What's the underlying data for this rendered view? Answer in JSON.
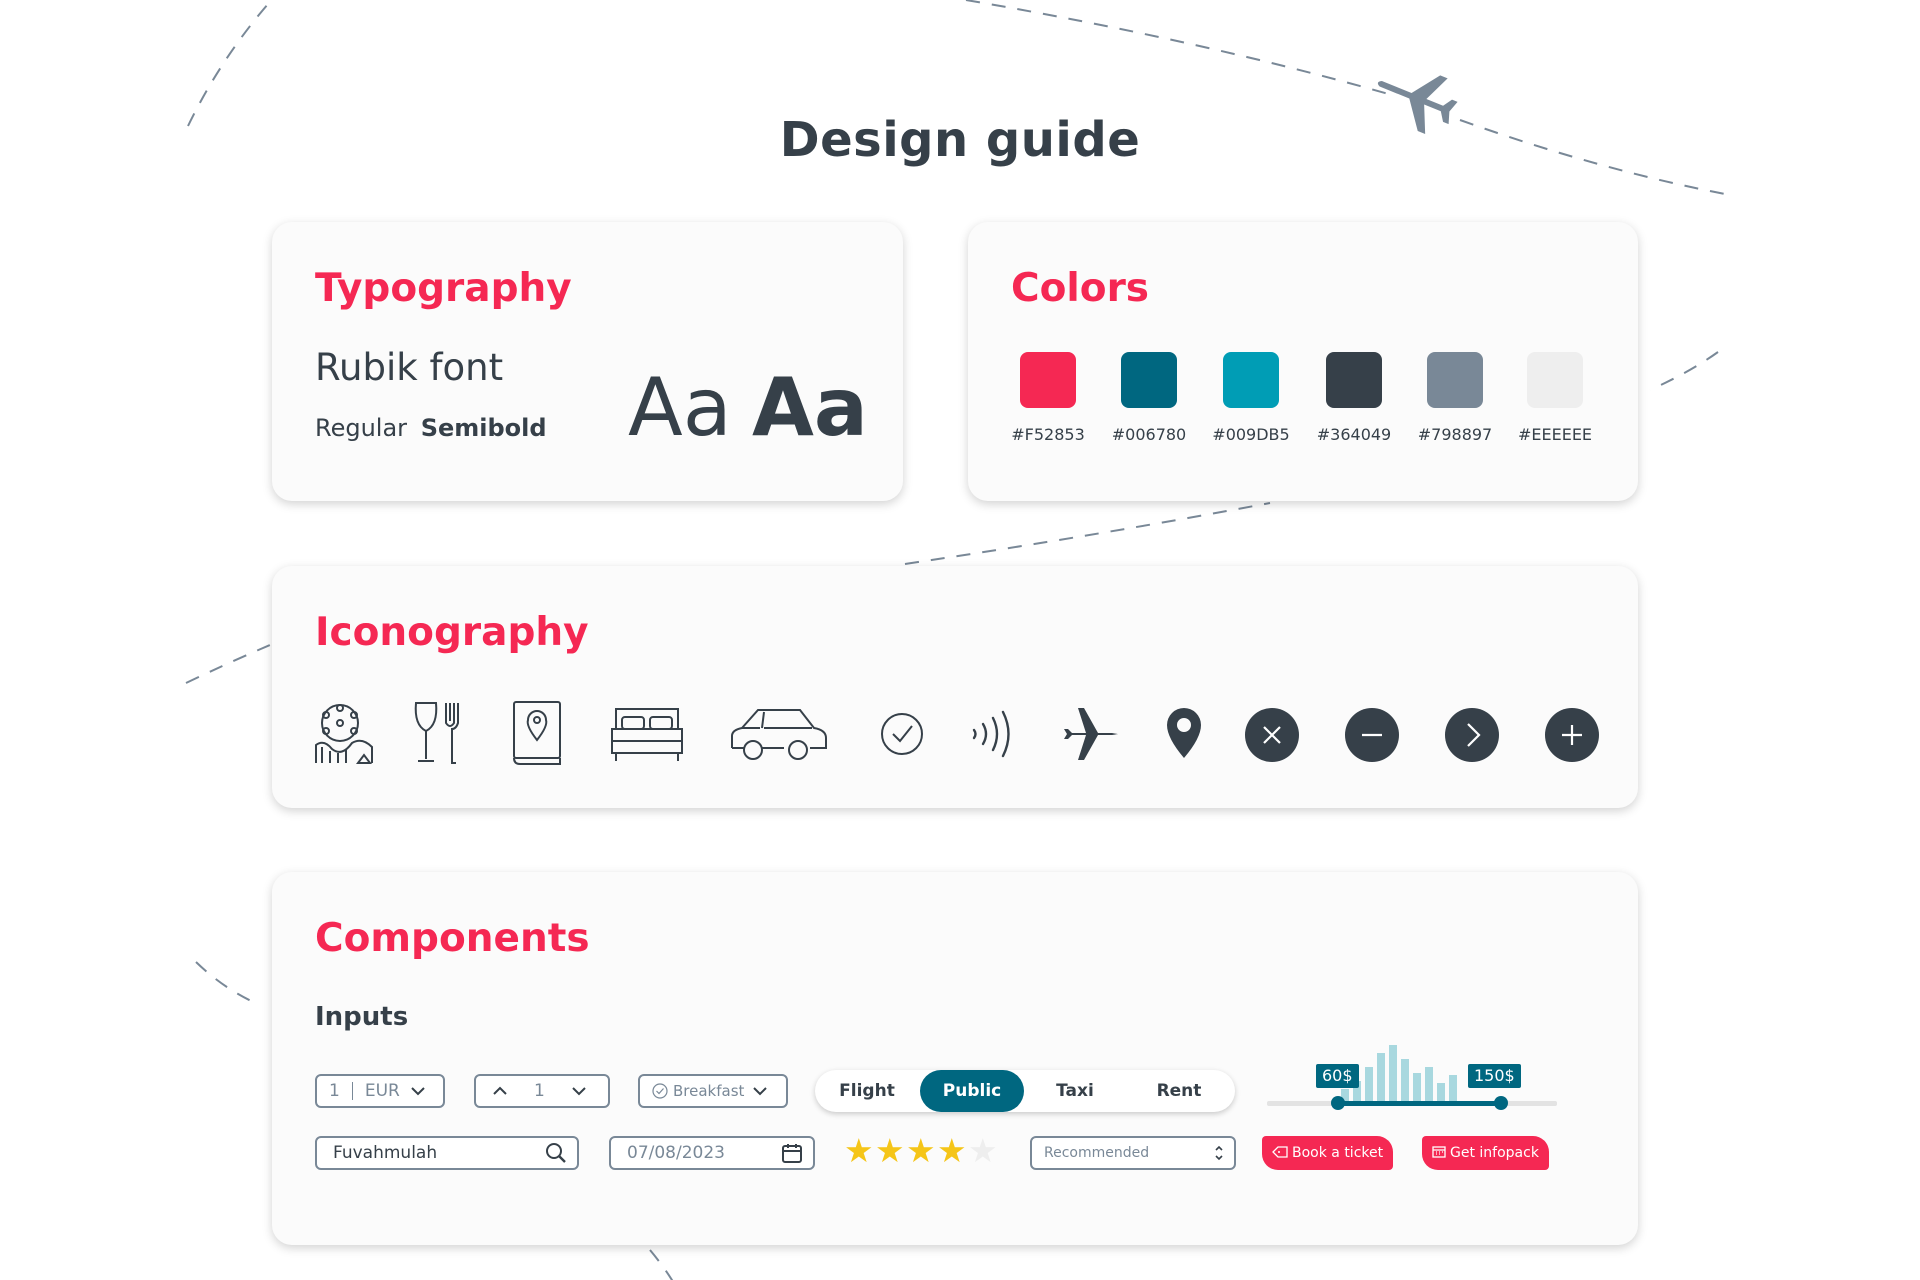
{
  "page": {
    "title": "Design guide"
  },
  "typography": {
    "title": "Typography",
    "font_name": "Rubik font",
    "weight_regular": "Regular",
    "weight_semibold": "Semibold",
    "sample_regular": "Aa",
    "sample_semibold": "Aa"
  },
  "colors": {
    "title": "Colors",
    "swatches": [
      {
        "hex": "#F52853",
        "label": "#F52853"
      },
      {
        "hex": "#006780",
        "label": "#006780"
      },
      {
        "hex": "#009DB5",
        "label": "#009DB5"
      },
      {
        "hex": "#364049",
        "label": "#364049"
      },
      {
        "hex": "#798897",
        "label": "#798897"
      },
      {
        "hex": "#EEEEEE",
        "label": "#EEEEEE"
      }
    ]
  },
  "iconography": {
    "title": "Iconography",
    "icons": [
      "theme-park-icon",
      "restaurant-icon",
      "guidebook-icon",
      "bed-icon",
      "car-icon",
      "check-circle-icon",
      "contactless-icon",
      "airplane-icon",
      "location-pin-icon",
      "close-circle-icon",
      "minus-circle-icon",
      "chevron-right-circle-icon",
      "plus-circle-icon"
    ]
  },
  "components": {
    "title": "Components",
    "inputs_heading": "Inputs",
    "currency": {
      "amount": "1",
      "currency": "EUR"
    },
    "stepper": {
      "value": "1"
    },
    "breakfast": {
      "label": "Breakfast"
    },
    "transport_tabs": [
      "Flight",
      "Public",
      "Taxi",
      "Rent"
    ],
    "active_tab": "Public",
    "range": {
      "min_label": "60$",
      "max_label": "150$"
    },
    "search": {
      "value": "Fuvahmulah"
    },
    "date": {
      "value": "07/08/2023"
    },
    "rating": {
      "value": 4,
      "max": 5
    },
    "sort": {
      "value": "Recommended"
    },
    "book_button": "Book a ticket",
    "infopack_button": "Get infopack"
  }
}
